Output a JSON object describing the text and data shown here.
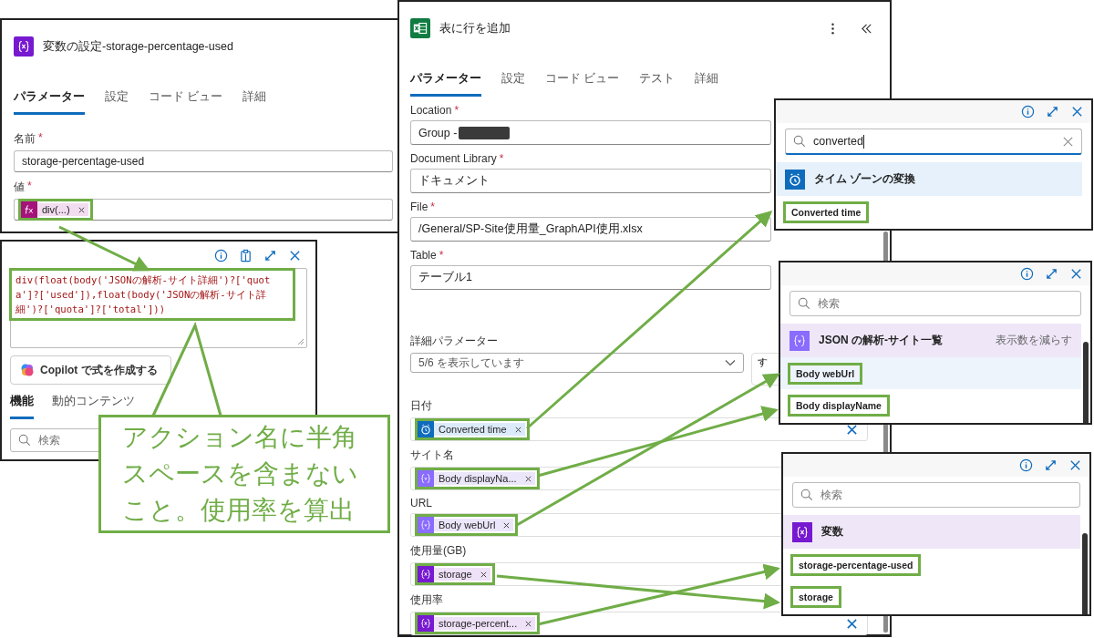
{
  "variable_panel": {
    "title": "変数の設定-storage-percentage-used",
    "tabs": [
      {
        "label": "パラメーター",
        "selected": true
      },
      {
        "label": "設定",
        "selected": false
      },
      {
        "label": "コード ビュー",
        "selected": false
      },
      {
        "label": "詳細",
        "selected": false
      }
    ],
    "name_field": {
      "label": "名前",
      "required_mark": "*",
      "value": "storage-percentage-used"
    },
    "value_field": {
      "label": "値",
      "required_mark": "*",
      "token": {
        "kind": "expression",
        "text": "div(...)",
        "highlighted": true
      }
    }
  },
  "expression_panel": {
    "code": "div(float(body('JSONの解析-サイト詳細')?['quota']?['used']),float(body('JSONの解析-サイト詳細')?['quota']?['total']))",
    "code_highlighted": true,
    "copilot_button": "Copilot で式を作成する",
    "tabs": [
      {
        "label": "機能",
        "selected": true
      },
      {
        "label": "動的コンテンツ",
        "selected": false
      }
    ],
    "search": {
      "placeholder": "検索"
    }
  },
  "callout": {
    "text": "アクション名に半角スペースを含まないこと。使用率を算出"
  },
  "action_panel": {
    "title": "表に行を追加",
    "tabs": [
      {
        "label": "パラメーター",
        "selected": true
      },
      {
        "label": "設定",
        "selected": false
      },
      {
        "label": "コード ビュー",
        "selected": false
      },
      {
        "label": "テスト",
        "selected": false
      },
      {
        "label": "詳細",
        "selected": false
      }
    ],
    "fields": [
      {
        "label": "Location",
        "required_mark": "*",
        "value": "Group - ",
        "redacted": true
      },
      {
        "label": "Document Library",
        "required_mark": "*",
        "value": "ドキュメント",
        "redacted": false
      },
      {
        "label": "File",
        "required_mark": "*",
        "value": "/General/SP-Site使用量_GraphAPI使用.xlsx",
        "redacted": false
      },
      {
        "label": "Table",
        "required_mark": "*",
        "value": "テーブル1",
        "redacted": false
      }
    ],
    "advanced": {
      "label": "詳細パラメーター",
      "value": "5/6 を表示しています",
      "button": [
        "す"
      ]
    },
    "params": [
      {
        "label": "日付",
        "token": {
          "kind": "time",
          "text": "Converted time",
          "highlighted": true
        },
        "clear_button": true
      },
      {
        "label": "サイト名",
        "token": {
          "kind": "json",
          "text": "Body displayNa...",
          "highlighted": true
        },
        "clear_button": false
      },
      {
        "label": "URL",
        "token": {
          "kind": "json",
          "text": "Body webUrl",
          "highlighted": true
        },
        "clear_button": false
      },
      {
        "label": "使用量(GB)",
        "token": {
          "kind": "variable",
          "text": "storage",
          "highlighted": true
        },
        "clear_button": false
      },
      {
        "label": "使用率",
        "token": {
          "kind": "variable",
          "text": "storage-percent...",
          "highlighted": true
        },
        "clear_button": true
      }
    ]
  },
  "pickers": [
    {
      "search": {
        "value": "converted",
        "focused": true
      },
      "group": {
        "kind": "time",
        "title": "タイム ゾーンの変換"
      },
      "items": [
        {
          "text": "Converted time",
          "selected": false,
          "highlighted": true
        }
      ]
    },
    {
      "search": {
        "placeholder": "検索",
        "focused": false
      },
      "group": {
        "kind": "json",
        "title": "JSON の解析-サイト一覧",
        "link": "表示数を減らす"
      },
      "items": [
        {
          "text": "Body webUrl",
          "selected": true,
          "highlighted": true
        },
        {
          "text": "Body displayName",
          "selected": false,
          "highlighted": true
        }
      ]
    },
    {
      "search": {
        "placeholder": "検索",
        "focused": false
      },
      "group": {
        "kind": "variable",
        "title": "変数"
      },
      "items": [
        {
          "text": "storage-percentage-used",
          "selected": false,
          "highlighted": true
        },
        {
          "text": "storage",
          "selected": false,
          "highlighted": true
        }
      ]
    }
  ]
}
